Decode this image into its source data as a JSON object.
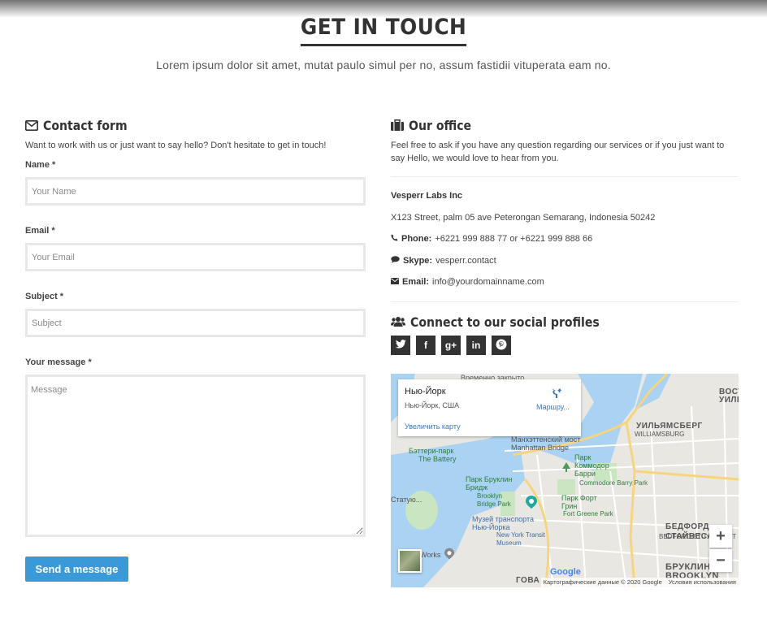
{
  "header": {
    "title": "GET IN TOUCH",
    "subtitle": "Lorem ipsum dolor sit amet, mutat paulo simul per no, assum fastidii vituperata eam no."
  },
  "contact_form": {
    "title": "Contact form",
    "icon": "envelope-icon",
    "intro": "Want to work with us or just want to say hello? Don't hesitate to get in touch!",
    "name_label": "Name *",
    "name_placeholder": "Your Name",
    "email_label": "Email *",
    "email_placeholder": "Your Email",
    "subject_label": "Subject *",
    "subject_placeholder": "Subject",
    "message_label": "Your message *",
    "message_placeholder": "Message",
    "send_label": "Send a message",
    "send_color": "#3a9ad9"
  },
  "office": {
    "title": "Our office",
    "icon": "briefcase-icon",
    "intro": "Feel free to ask if you have any question regarding our services or if you just want to say Hello, we would love to hear from you.",
    "company": "Vesperr Labs Inc",
    "address": "X123 Street, palm 05 ave Peterongan Semarang, Indonesia 50242",
    "phone_label": "Phone:",
    "phone_value": "+6221 999 888 77 or +6221 999 888 66",
    "skype_label": "Skype:",
    "skype_value": "vesperr.contact",
    "email_label": "Email:",
    "email_value": "info@yourdomainname.com"
  },
  "social": {
    "title": "Connect to our social profiles",
    "icon": "users-icon",
    "items": [
      {
        "name": "twitter",
        "glyph": "t"
      },
      {
        "name": "facebook",
        "glyph": "f"
      },
      {
        "name": "google-plus",
        "glyph": "g+"
      },
      {
        "name": "linkedin",
        "glyph": "in"
      },
      {
        "name": "pinterest",
        "glyph": "p"
      }
    ]
  },
  "map": {
    "card_title": "Нью-Йорк",
    "card_subtitle": "Нью-Йорк, США",
    "card_link": "Увеличить карту",
    "route_label": "Маршру...",
    "top_label": "Временно закрыто",
    "labels": {
      "battery_park": "Бэттери-парк",
      "the_battery": "The Battery",
      "manhattan_bridge_ru": "Манхэттенский мост",
      "manhattan_bridge_en": "Manhattan Bridge",
      "williamsburg_ru": "УИЛЬЯМСБЕРГ",
      "williamsburg_en": "WILLIAMSBURG",
      "commodore_park": "Парк Коммодор Барри",
      "commodore_park_en": "Commodore Barry Park",
      "brooklyn_bridge_park": "Парк Бруклин Бридж",
      "brooklyn_bridge_park_en": "Brooklyn Bridge Park",
      "fort_greene": "Парк Форт Грин",
      "fort_greene_en": "Fort Greene Park",
      "transit_museum": "Музей транспорта Нью-Йорка",
      "transit_museum_en": "New York Transit Museum",
      "statue": "Статую...",
      "works": "Works",
      "bedford": "БЕДФОРД СТАЙВЕСАНТ",
      "bedford_en": "BEDFORD-STUYVESANT",
      "brooklyn_ru": "БРУКЛИН",
      "brooklyn_en": "BROOKLYN",
      "east_william": "ВОСТ УИЛЬЯМ",
      "gov": "ГОВА"
    },
    "attribution": "Картографические данные © 2020 Google",
    "terms": "Условия использования",
    "google": "Google",
    "zoom_in": "+",
    "zoom_out": "−"
  }
}
